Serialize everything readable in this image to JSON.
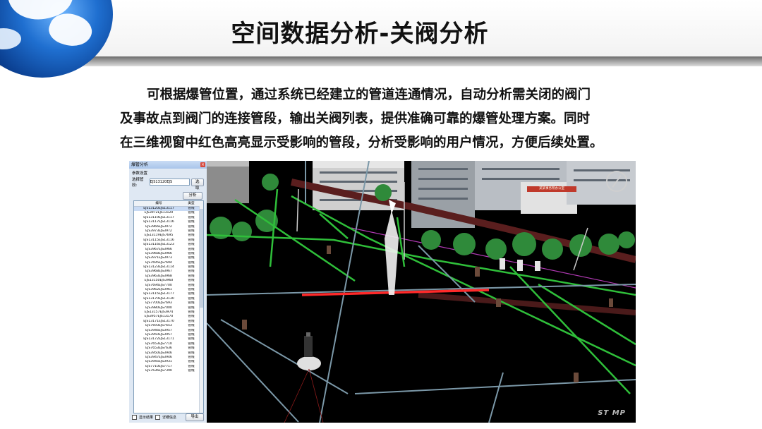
{
  "slide": {
    "title": "空间数据分析-关阀分析",
    "paragraph_line1": "可根据爆管位置，通过系统已经建立的管道连通情况，自动分析需关闭的阀门",
    "paragraph_line2": "及事故点到阀门的连接管段，输出关阀列表，提供准确可靠的爆管处理方案。同时",
    "paragraph_line3": "在三维视窗中红色高亮显示受影响的管段，分析受影响的用户情况，方便后续处置。"
  },
  "dialog": {
    "title": "爆管分析",
    "close_label": "×",
    "group_label": "参数设置",
    "select_label": "选择管段:",
    "selected_value": "EJS13120EJS",
    "select_button": "选取",
    "analyze_button": "分析",
    "columns": [
      "编号",
      "类型"
    ],
    "rows": [
      [
        "EJS13120EJS13117",
        "管线"
      ],
      [
        "EJS3972EJS13120",
        "管线"
      ],
      [
        "EJS13119EJS13117",
        "管线"
      ],
      [
        "EJS13117EJS13116",
        "管线"
      ],
      [
        "EJS3966EJS3972",
        "管线"
      ],
      [
        "EJS3973EJS3972",
        "管线"
      ],
      [
        "EJS13119EJS7695",
        "管线"
      ],
      [
        "EJS13115EJS13116",
        "管线"
      ],
      [
        "EJS13116EJS13123",
        "管线"
      ],
      [
        "EJS3967EJS3966",
        "管线"
      ],
      [
        "EJS3968EJS3966",
        "管线"
      ],
      [
        "EJS3971EJS3973",
        "管线"
      ],
      [
        "EJS7695EJS7694",
        "管线"
      ],
      [
        "EJS13123EJS13114",
        "管线"
      ],
      [
        "EJS3968EJS3967",
        "管线"
      ],
      [
        "EJS3963EJS3968",
        "管线"
      ],
      [
        "EJS13150EJS3960",
        "管线"
      ],
      [
        "EJS7694EJS7700",
        "管线"
      ],
      [
        "EJS3962EJS3961",
        "管线"
      ],
      [
        "EJS13115EJS13177",
        "管线"
      ],
      [
        "EJS13170EJS13130",
        "管线"
      ],
      [
        "EJS7700EJS7693",
        "管线"
      ],
      [
        "EJS3980EJS7000",
        "管线"
      ],
      [
        "EJS13157EJS3974",
        "管线"
      ],
      [
        "EJS3957EJS13170",
        "管线"
      ],
      [
        "EJS13171EJS13170",
        "管线"
      ],
      [
        "EJS7693EJS7653",
        "管线"
      ],
      [
        "EJS3946EJS3957",
        "管线"
      ],
      [
        "EJS3950EJS3957",
        "管线"
      ],
      [
        "EJS13172EJS13171",
        "管线"
      ],
      [
        "EJS7653EJS7710",
        "管线"
      ],
      [
        "EJS7653EJS7636",
        "管线"
      ],
      [
        "EJS3950EJS3946",
        "管线"
      ],
      [
        "EJS3947EJS3946",
        "管线"
      ],
      [
        "EJS3945EJS3931",
        "管线"
      ],
      [
        "EJS7710EJS7717",
        "管线"
      ],
      [
        "EJS7636EJS7390",
        "管线"
      ]
    ],
    "show_result_label": "显示结果",
    "detail_label": "详细信息",
    "export_button": "导出"
  },
  "scene": {
    "sign_text": "某某事务所办公室",
    "watermark": "ST  MP",
    "highlight_color": "#ff2a2a",
    "pipe_color": "#2fbf3a",
    "aux_pipe_color": "#7b98a8"
  }
}
